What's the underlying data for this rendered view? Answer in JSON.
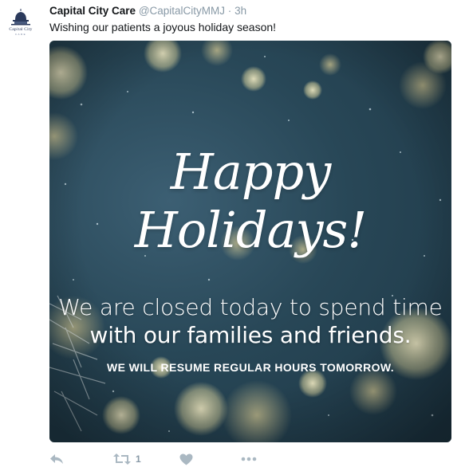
{
  "tweet": {
    "display_name": "Capital City Care",
    "handle": "@CapitalCityMMJ",
    "separator": "·",
    "time": "3h",
    "text": "Wishing our patients a joyous holiday season!",
    "avatar": {
      "logo_text": "Capital City",
      "logo_subtext": "CARE"
    },
    "media": {
      "headline": "Happy Holidays!",
      "line1": "We are closed today to spend time",
      "line2": "with our families and friends.",
      "line3": "WE WILL RESUME REGULAR HOURS TOMORROW."
    },
    "actions": {
      "reply_icon": "reply-icon",
      "retweet_icon": "retweet-icon",
      "retweet_count": "1",
      "like_icon": "heart-icon",
      "more_icon": "more-icon"
    }
  },
  "colors": {
    "text": "#14171a",
    "secondary": "#8899a6",
    "icon": "#aab8c2",
    "media_bg": "#284757"
  }
}
